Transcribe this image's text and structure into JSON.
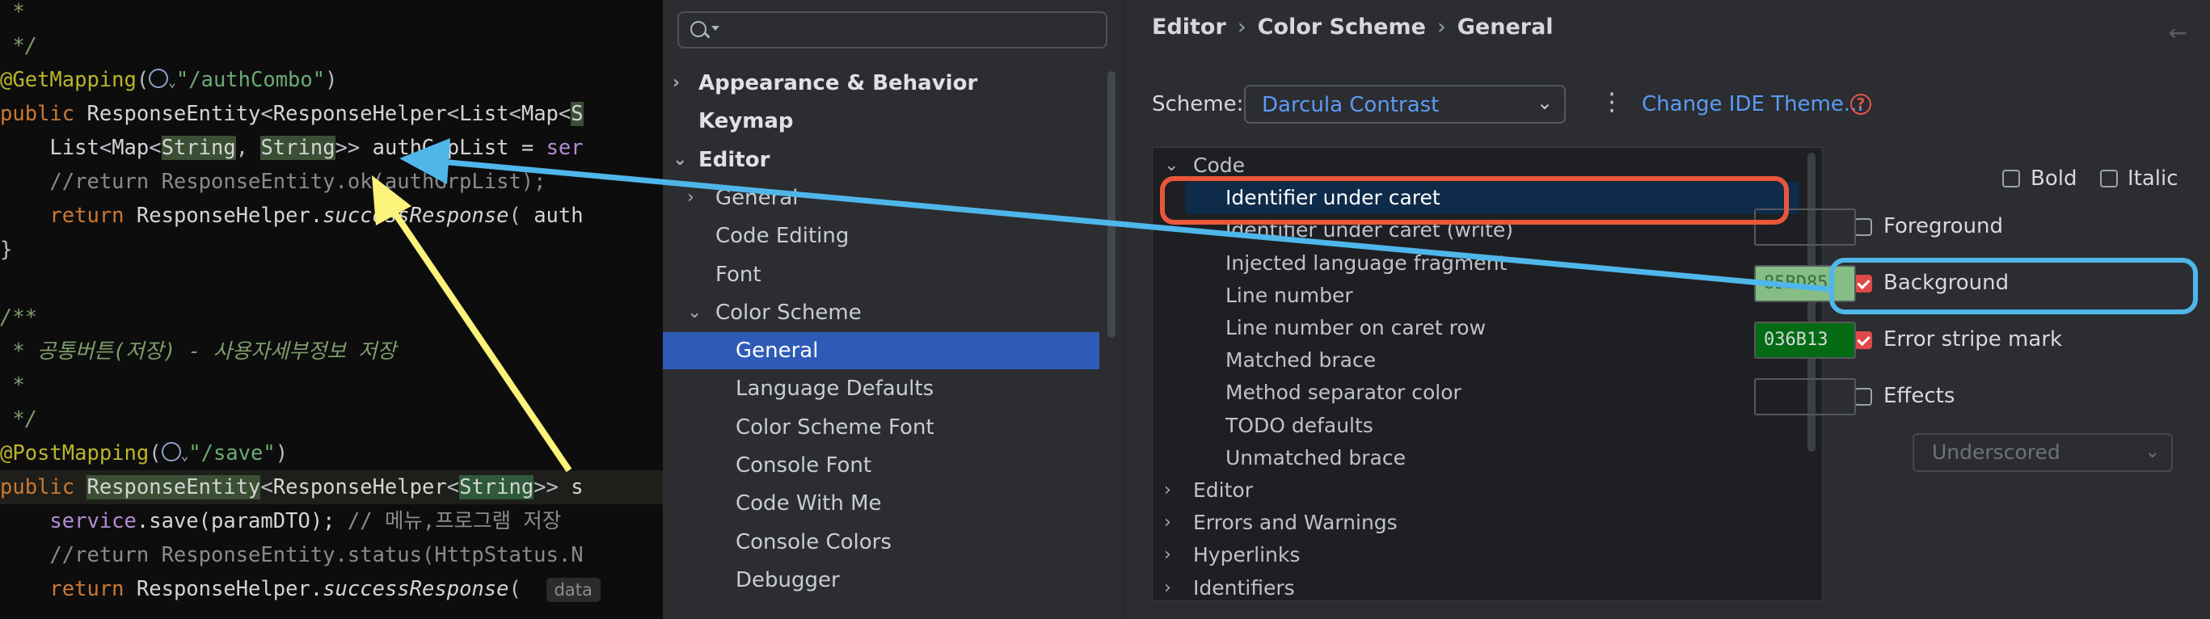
{
  "code_editor": {
    "lines": [
      {
        "t": [
          [
            "t-cmk",
            " *"
          ]
        ]
      },
      {
        "t": [
          [
            "t-cmk",
            " */"
          ]
        ]
      },
      {
        "t": [
          [
            "t-an",
            "@GetMapping"
          ],
          [
            "t-sym",
            "("
          ],
          [
            "icon",
            ""
          ],
          [
            "t-str",
            "\"/authCombo\""
          ],
          [
            "t-sym",
            ")"
          ]
        ]
      },
      {
        "t": [
          [
            "t-kw",
            "public "
          ],
          [
            "t-ty",
            "ResponseEntity"
          ],
          [
            "t-sym",
            "<"
          ],
          [
            "t-ty",
            "ResponseHelper"
          ],
          [
            "t-sym",
            "<"
          ],
          [
            "t-ty",
            "List"
          ],
          [
            "t-sym",
            "<"
          ],
          [
            "t-ty",
            "Map"
          ],
          [
            "t-sym",
            "<"
          ],
          [
            "t-id",
            "S"
          ]
        ]
      },
      {
        "t": [
          [
            "t-ty",
            "    List"
          ],
          [
            "t-sym",
            "<"
          ],
          [
            "t-ty",
            "Map"
          ],
          [
            "t-sym",
            "<"
          ],
          [
            "t-id",
            "String"
          ],
          [
            "t-sym",
            ", "
          ],
          [
            "t-id",
            "String"
          ],
          [
            "t-sym",
            ">> "
          ],
          [
            "t-ty",
            "authGrpList = "
          ],
          [
            "t-pu",
            "ser"
          ]
        ]
      },
      {
        "t": [
          [
            "t-cm",
            "    //return ResponseEntity.ok(authGrpList);"
          ]
        ]
      },
      {
        "t": [
          [
            "t-kw",
            "    return "
          ],
          [
            "t-ty",
            "ResponseHelper."
          ],
          [
            "t-it",
            "successResponse"
          ],
          [
            "t-sym",
            "( "
          ],
          [
            "t-ty",
            "auth"
          ]
        ]
      },
      {
        "t": [
          [
            "t-sym",
            "}"
          ]
        ]
      },
      {
        "t": [
          [
            "t-ty",
            " "
          ]
        ]
      },
      {
        "t": [
          [
            "t-cmk",
            "/**"
          ]
        ]
      },
      {
        "t": [
          [
            "t-cmk",
            " * 공통버튼(저장) - 사용자세부정보 저장"
          ]
        ]
      },
      {
        "t": [
          [
            "t-cmk",
            " *"
          ]
        ]
      },
      {
        "t": [
          [
            "t-cmk",
            " */"
          ]
        ]
      },
      {
        "t": [
          [
            "t-an",
            "@PostMapping"
          ],
          [
            "t-sym",
            "("
          ],
          [
            "icon",
            ""
          ],
          [
            "t-str",
            "\"/save\""
          ],
          [
            "t-sym",
            ")"
          ]
        ]
      },
      {
        "t": [
          [
            "t-kw",
            "public "
          ],
          [
            "t-id",
            "ResponseEntity"
          ],
          [
            "t-sym",
            "<"
          ],
          [
            "t-ty",
            "ResponseHelper"
          ],
          [
            "t-sym",
            "<"
          ],
          [
            "t-idb",
            "String"
          ],
          [
            "t-sym",
            ">> "
          ],
          [
            "t-ty",
            "s"
          ]
        ],
        "hl": true
      },
      {
        "t": [
          [
            "t-pu",
            "    service"
          ],
          [
            "t-ty",
            ".save(paramDTO); "
          ],
          [
            "t-cm",
            "// 메뉴,프로그램 저장"
          ]
        ]
      },
      {
        "t": [
          [
            "t-cm",
            "    //return ResponseEntity.status(HttpStatus.N"
          ]
        ]
      },
      {
        "t": [
          [
            "t-kw",
            "    return "
          ],
          [
            "t-ty",
            "ResponseHelper."
          ],
          [
            "t-it",
            "successResponse"
          ],
          [
            "t-sym",
            "(  "
          ],
          [
            "hint",
            "data"
          ]
        ]
      }
    ]
  },
  "tree": {
    "search_placeholder": "",
    "items": [
      {
        "label": "Appearance & Behavior",
        "bold": true,
        "indent": 0,
        "chev": "›"
      },
      {
        "label": "Keymap",
        "bold": true,
        "indent": 0,
        "chev": ""
      },
      {
        "label": "Editor",
        "bold": true,
        "indent": 0,
        "chev": "⌄"
      },
      {
        "label": "General",
        "bold": false,
        "indent": 1,
        "chev": "›"
      },
      {
        "label": "Code Editing",
        "bold": false,
        "indent": 1,
        "chev": ""
      },
      {
        "label": "Font",
        "bold": false,
        "indent": 1,
        "chev": ""
      },
      {
        "label": "Color Scheme",
        "bold": false,
        "indent": 1,
        "chev": "⌄"
      },
      {
        "label": "General",
        "bold": false,
        "indent": 2,
        "chev": "",
        "selected": true
      },
      {
        "label": "Language Defaults",
        "bold": false,
        "indent": 2,
        "chev": ""
      },
      {
        "label": "Color Scheme Font",
        "bold": false,
        "indent": 2,
        "chev": ""
      },
      {
        "label": "Console Font",
        "bold": false,
        "indent": 2,
        "chev": ""
      },
      {
        "label": "Code With Me",
        "bold": false,
        "indent": 2,
        "chev": ""
      },
      {
        "label": "Console Colors",
        "bold": false,
        "indent": 2,
        "chev": ""
      },
      {
        "label": "Debugger",
        "bold": false,
        "indent": 2,
        "chev": ""
      }
    ]
  },
  "panel": {
    "breadcrumb": [
      "Editor",
      "Color Scheme",
      "General"
    ],
    "scheme_label": "Scheme:",
    "scheme_value": "Darcula Contrast",
    "theme_link": "Change IDE Theme...",
    "help": "?",
    "list_items": [
      {
        "label": "Code",
        "chev": "⌄",
        "indent": 0
      },
      {
        "label": "Identifier under caret",
        "chev": "",
        "indent": 1,
        "selected": true
      },
      {
        "label": "Identifier under caret (write)",
        "chev": "",
        "indent": 1
      },
      {
        "label": "Injected language fragment",
        "chev": "",
        "indent": 1
      },
      {
        "label": "Line number",
        "chev": "",
        "indent": 1
      },
      {
        "label": "Line number on caret row",
        "chev": "",
        "indent": 1
      },
      {
        "label": "Matched brace",
        "chev": "",
        "indent": 1
      },
      {
        "label": "Method separator color",
        "chev": "",
        "indent": 1
      },
      {
        "label": "TODO defaults",
        "chev": "",
        "indent": 1
      },
      {
        "label": "Unmatched brace",
        "chev": "",
        "indent": 1
      },
      {
        "label": "Editor",
        "chev": "›",
        "indent": 0
      },
      {
        "label": "Errors and Warnings",
        "chev": "›",
        "indent": 0
      },
      {
        "label": "Hyperlinks",
        "chev": "›",
        "indent": 0
      },
      {
        "label": "Identifiers",
        "chev": "›",
        "indent": 0
      }
    ],
    "bold_label": "Bold",
    "italic_label": "Italic",
    "foreground_label": "Foreground",
    "background_label": "Background",
    "background_value": "85BD85",
    "background_color": "#85bd85",
    "error_stripe_label": "Error stripe mark",
    "error_stripe_value": "036B13",
    "error_stripe_color": "#036b13",
    "effects_label": "Effects",
    "effects_value": "Underscored"
  },
  "colors": {
    "selection_blue": "#2f5bb7",
    "highlight_red": "#e8573a",
    "annotation_blue": "#4fb6ea",
    "annotation_yellow": "#fbf37a"
  }
}
